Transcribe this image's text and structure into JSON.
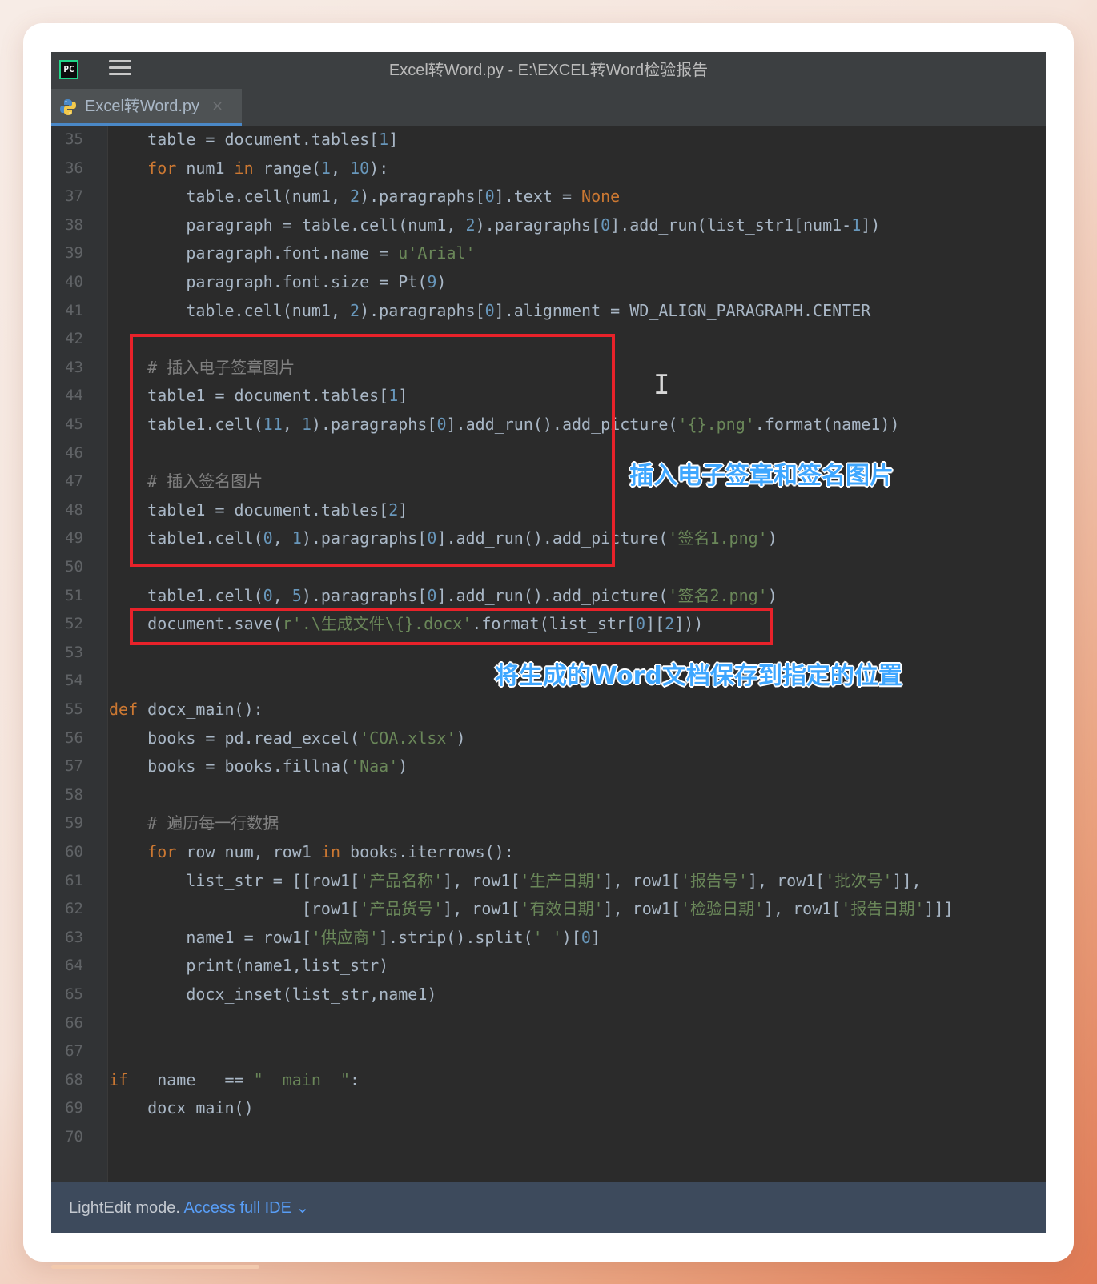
{
  "window": {
    "title": "Excel转Word.py - E:\\EXCEL转Word检验报告",
    "app_icon": "pycharm-icon",
    "app_icon_text": "PC",
    "menu_icon": "hamburger-menu-icon"
  },
  "tabs": [
    {
      "label": "Excel转Word.py",
      "icon": "python-file-icon",
      "close": "×"
    }
  ],
  "editor": {
    "lines": [
      {
        "num": "35",
        "tokens": [
          [
            "t",
            "    table = document.tables["
          ],
          [
            "n",
            "1"
          ],
          [
            "t",
            "]"
          ]
        ]
      },
      {
        "num": "36",
        "tokens": [
          [
            "k",
            "    for "
          ],
          [
            "t",
            "num1 "
          ],
          [
            "k",
            "in "
          ],
          [
            "t",
            "range("
          ],
          [
            "n",
            "1"
          ],
          [
            "t",
            ", "
          ],
          [
            "n",
            "10"
          ],
          [
            "t",
            "):"
          ]
        ]
      },
      {
        "num": "37",
        "tokens": [
          [
            "t",
            "        table.cell(num1, "
          ],
          [
            "n",
            "2"
          ],
          [
            "t",
            ").paragraphs["
          ],
          [
            "n",
            "0"
          ],
          [
            "t",
            "].text = "
          ],
          [
            "k",
            "None"
          ]
        ]
      },
      {
        "num": "38",
        "tokens": [
          [
            "t",
            "        paragraph = table.cell(num1, "
          ],
          [
            "n",
            "2"
          ],
          [
            "t",
            ").paragraphs["
          ],
          [
            "n",
            "0"
          ],
          [
            "t",
            "].add_run(list_str1[num1-"
          ],
          [
            "n",
            "1"
          ],
          [
            "t",
            "])"
          ]
        ]
      },
      {
        "num": "39",
        "tokens": [
          [
            "t",
            "        paragraph.font.name = "
          ],
          [
            "s",
            "u'Arial'"
          ]
        ]
      },
      {
        "num": "40",
        "tokens": [
          [
            "t",
            "        paragraph.font.size = Pt("
          ],
          [
            "n",
            "9"
          ],
          [
            "t",
            ")"
          ]
        ]
      },
      {
        "num": "41",
        "tokens": [
          [
            "t",
            "        table.cell(num1, "
          ],
          [
            "n",
            "2"
          ],
          [
            "t",
            ").paragraphs["
          ],
          [
            "n",
            "0"
          ],
          [
            "t",
            "].alignment = WD_ALIGN_PARAGRAPH.CENTER"
          ]
        ]
      },
      {
        "num": "42",
        "tokens": []
      },
      {
        "num": "43",
        "tokens": [
          [
            "c",
            "    # 插入电子签章图片"
          ]
        ]
      },
      {
        "num": "44",
        "tokens": [
          [
            "t",
            "    table1 = document.tables["
          ],
          [
            "n",
            "1"
          ],
          [
            "t",
            "]"
          ]
        ]
      },
      {
        "num": "45",
        "tokens": [
          [
            "t",
            "    table1.cell("
          ],
          [
            "n",
            "11"
          ],
          [
            "t",
            ", "
          ],
          [
            "n",
            "1"
          ],
          [
            "t",
            ").paragraphs["
          ],
          [
            "n",
            "0"
          ],
          [
            "t",
            "].add_run().add_picture("
          ],
          [
            "s",
            "'{}.png'"
          ],
          [
            "t",
            ".format(name1))"
          ]
        ]
      },
      {
        "num": "46",
        "tokens": []
      },
      {
        "num": "47",
        "tokens": [
          [
            "c",
            "    # 插入签名图片"
          ]
        ]
      },
      {
        "num": "48",
        "tokens": [
          [
            "t",
            "    table1 = document.tables["
          ],
          [
            "n",
            "2"
          ],
          [
            "t",
            "]"
          ]
        ]
      },
      {
        "num": "49",
        "tokens": [
          [
            "t",
            "    table1.cell("
          ],
          [
            "n",
            "0"
          ],
          [
            "t",
            ", "
          ],
          [
            "n",
            "1"
          ],
          [
            "t",
            ").paragraphs["
          ],
          [
            "n",
            "0"
          ],
          [
            "t",
            "].add_run().add_picture("
          ],
          [
            "s",
            "'签名1.png'"
          ],
          [
            "t",
            ")"
          ]
        ]
      },
      {
        "num": "50",
        "tokens": []
      },
      {
        "num": "51",
        "tokens": [
          [
            "t",
            "    table1.cell("
          ],
          [
            "n",
            "0"
          ],
          [
            "t",
            ", "
          ],
          [
            "n",
            "5"
          ],
          [
            "t",
            ").paragraphs["
          ],
          [
            "n",
            "0"
          ],
          [
            "t",
            "].add_run().add_picture("
          ],
          [
            "s",
            "'签名2.png'"
          ],
          [
            "t",
            ")"
          ]
        ]
      },
      {
        "num": "52",
        "tokens": [
          [
            "t",
            "    document.save("
          ],
          [
            "s",
            "r'.\\生成文件\\{}.docx'"
          ],
          [
            "t",
            ".format(list_str["
          ],
          [
            "n",
            "0"
          ],
          [
            "t",
            "]["
          ],
          [
            "n",
            "2"
          ],
          [
            "t",
            "]))"
          ]
        ]
      },
      {
        "num": "53",
        "tokens": []
      },
      {
        "num": "54",
        "tokens": []
      },
      {
        "num": "55",
        "tokens": [
          [
            "k",
            "def "
          ],
          [
            "t",
            "docx_main():"
          ]
        ]
      },
      {
        "num": "56",
        "tokens": [
          [
            "t",
            "    books = pd.read_excel("
          ],
          [
            "s",
            "'COA.xlsx'"
          ],
          [
            "t",
            ")"
          ]
        ]
      },
      {
        "num": "57",
        "tokens": [
          [
            "t",
            "    books = books.fillna("
          ],
          [
            "s",
            "'Naa'"
          ],
          [
            "t",
            ")"
          ]
        ]
      },
      {
        "num": "58",
        "tokens": []
      },
      {
        "num": "59",
        "tokens": [
          [
            "c",
            "    # 遍历每一行数据"
          ]
        ]
      },
      {
        "num": "60",
        "tokens": [
          [
            "k",
            "    for "
          ],
          [
            "t",
            "row_num, row1 "
          ],
          [
            "k",
            "in "
          ],
          [
            "t",
            "books.iterrows():"
          ]
        ]
      },
      {
        "num": "61",
        "tokens": [
          [
            "t",
            "        list_str = [[row1["
          ],
          [
            "s",
            "'产品名称'"
          ],
          [
            "t",
            "], row1["
          ],
          [
            "s",
            "'生产日期'"
          ],
          [
            "t",
            "], row1["
          ],
          [
            "s",
            "'报告号'"
          ],
          [
            "t",
            "], row1["
          ],
          [
            "s",
            "'批次号'"
          ],
          [
            "t",
            "]],"
          ]
        ]
      },
      {
        "num": "62",
        "tokens": [
          [
            "t",
            "                    [row1["
          ],
          [
            "s",
            "'产品货号'"
          ],
          [
            "t",
            "], row1["
          ],
          [
            "s",
            "'有效日期'"
          ],
          [
            "t",
            "], row1["
          ],
          [
            "s",
            "'检验日期'"
          ],
          [
            "t",
            "], row1["
          ],
          [
            "s",
            "'报告日期'"
          ],
          [
            "t",
            "]]]"
          ]
        ]
      },
      {
        "num": "63",
        "tokens": [
          [
            "t",
            "        name1 = row1["
          ],
          [
            "s",
            "'供应商'"
          ],
          [
            "t",
            "].strip().split("
          ],
          [
            "s",
            "' '"
          ],
          [
            "t",
            ")["
          ],
          [
            "n",
            "0"
          ],
          [
            "t",
            "]"
          ]
        ]
      },
      {
        "num": "64",
        "tokens": [
          [
            "t",
            "        print(name1,list_str)"
          ]
        ]
      },
      {
        "num": "65",
        "tokens": [
          [
            "t",
            "        docx_inset(list_str,name1)"
          ]
        ]
      },
      {
        "num": "66",
        "tokens": []
      },
      {
        "num": "67",
        "tokens": []
      },
      {
        "num": "68",
        "tokens": [
          [
            "k",
            "if "
          ],
          [
            "t",
            "__name__ == "
          ],
          [
            "s",
            "\"__main__\""
          ],
          [
            "t",
            ":"
          ]
        ]
      },
      {
        "num": "69",
        "tokens": [
          [
            "t",
            "    docx_main()"
          ]
        ]
      },
      {
        "num": "70",
        "tokens": []
      }
    ]
  },
  "annotations": {
    "signature": "插入电子签章和签名图片",
    "save": "将生成的Word文档保存到指定的位置"
  },
  "cursor_icon": "text-cursor-icon",
  "cursor_glyph": "I",
  "status": {
    "mode": "LightEdit mode.",
    "link": "Access full IDE",
    "chevron": "⌄"
  },
  "colors": {
    "editor_bg": "#2b2b2b",
    "keyword": "#cc7832",
    "number": "#6897bb",
    "string": "#6a8759",
    "comment": "#808080",
    "highlight_box": "#e8222a",
    "annotation": "#3fa7ff"
  }
}
